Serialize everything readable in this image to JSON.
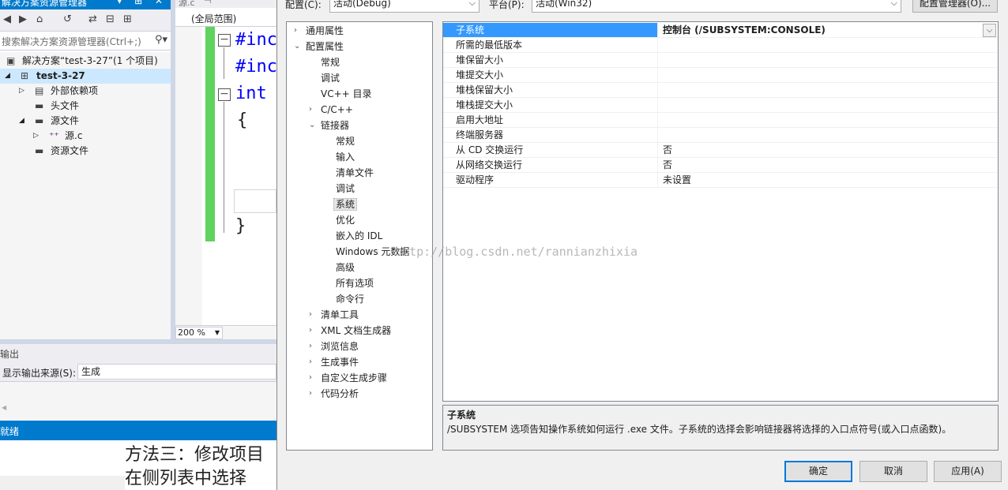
{
  "solution_explorer": {
    "title": "解决方案资源管理器",
    "title_buttons": "▾ ⊞ ✕",
    "search_placeholder": "搜索解决方案资源管理器(Ctrl+;)",
    "toolbar_icons": [
      "back-icon",
      "forward-icon",
      "home-icon",
      "history-icon",
      "sync-icon",
      "collapse-icon",
      "properties-icon"
    ],
    "tree": [
      {
        "label": "解决方案“test-3-27”(1 个项目)",
        "icon": "solution-icon",
        "arrow": ""
      },
      {
        "label": "test-3-27",
        "icon": "project-icon",
        "arrow": "◢",
        "bold": true,
        "selected": true
      },
      {
        "label": "外部依赖项",
        "icon": "dependencies-icon",
        "arrow": "▷"
      },
      {
        "label": "头文件",
        "icon": "folder-icon",
        "arrow": ""
      },
      {
        "label": "源文件",
        "icon": "folder-icon",
        "arrow": "◢"
      },
      {
        "label": "源.c",
        "icon": "c-file-icon",
        "arrow": "▷"
      },
      {
        "label": "资源文件",
        "icon": "folder-icon",
        "arrow": ""
      }
    ]
  },
  "editor": {
    "tab_label": "源.c",
    "scope": "(全局范围)",
    "code": [
      "#inc",
      "#inc",
      "int"
    ],
    "open_brace": "{",
    "close_brace": "}",
    "zoom": "200 %"
  },
  "output": {
    "title": "输出",
    "source_label": "显示输出来源(S):",
    "source_value": "生成"
  },
  "status_bar": {
    "text": "就绪"
  },
  "article": {
    "line1": "方法三：修改项目",
    "line2": "在侧列表中选择"
  },
  "dialog": {
    "config_label": "配置(C):",
    "config_value": "活动(Debug)",
    "platform_label": "平台(P):",
    "platform_value": "活动(Win32)",
    "config_manager": "配置管理器(O)...",
    "tree": [
      {
        "label": "通用属性",
        "indent": 0,
        "expand": "›"
      },
      {
        "label": "配置属性",
        "indent": 0,
        "expand": "⌄"
      },
      {
        "label": "常规",
        "indent": 1
      },
      {
        "label": "调试",
        "indent": 1
      },
      {
        "label": "VC++ 目录",
        "indent": 1
      },
      {
        "label": "C/C++",
        "indent": 1,
        "expand": "›"
      },
      {
        "label": "链接器",
        "indent": 1,
        "expand": "⌄"
      },
      {
        "label": "常规",
        "indent": 2
      },
      {
        "label": "输入",
        "indent": 2
      },
      {
        "label": "清单文件",
        "indent": 2
      },
      {
        "label": "调试",
        "indent": 2
      },
      {
        "label": "系统",
        "indent": 2,
        "selected": true
      },
      {
        "label": "优化",
        "indent": 2
      },
      {
        "label": "嵌入的 IDL",
        "indent": 2
      },
      {
        "label": "Windows 元数据",
        "indent": 2
      },
      {
        "label": "高级",
        "indent": 2
      },
      {
        "label": "所有选项",
        "indent": 2
      },
      {
        "label": "命令行",
        "indent": 2
      },
      {
        "label": "清单工具",
        "indent": 1,
        "expand": "›"
      },
      {
        "label": "XML 文档生成器",
        "indent": 1,
        "expand": "›"
      },
      {
        "label": "浏览信息",
        "indent": 1,
        "expand": "›"
      },
      {
        "label": "生成事件",
        "indent": 1,
        "expand": "›"
      },
      {
        "label": "自定义生成步骤",
        "indent": 1,
        "expand": "›"
      },
      {
        "label": "代码分析",
        "indent": 1,
        "expand": "›"
      }
    ],
    "properties": [
      {
        "name": "子系统",
        "value": "控制台 (/SUBSYSTEM:CONSOLE)",
        "selected": true
      },
      {
        "name": "所需的最低版本",
        "value": ""
      },
      {
        "name": "堆保留大小",
        "value": ""
      },
      {
        "name": "堆提交大小",
        "value": ""
      },
      {
        "name": "堆栈保留大小",
        "value": ""
      },
      {
        "name": "堆栈提交大小",
        "value": ""
      },
      {
        "name": "启用大地址",
        "value": ""
      },
      {
        "name": "终端服务器",
        "value": ""
      },
      {
        "name": "从 CD 交换运行",
        "value": "否"
      },
      {
        "name": "从网络交换运行",
        "value": "否"
      },
      {
        "name": "驱动程序",
        "value": "未设置"
      }
    ],
    "description": {
      "title": "子系统",
      "text": "/SUBSYSTEM 选项告知操作系统如何运行 .exe 文件。子系统的选择会影响链接器将选择的入口点符号(或入口点函数)。"
    },
    "buttons": {
      "ok": "确定",
      "cancel": "取消",
      "apply": "应用(A)"
    }
  },
  "watermark": "http://blog.csdn.net/rannianzhixia",
  "colors": {
    "accent": "#007acc",
    "selection": "#3399ff",
    "change_bar": "#5ed35e",
    "keyword": "#0000ff"
  }
}
